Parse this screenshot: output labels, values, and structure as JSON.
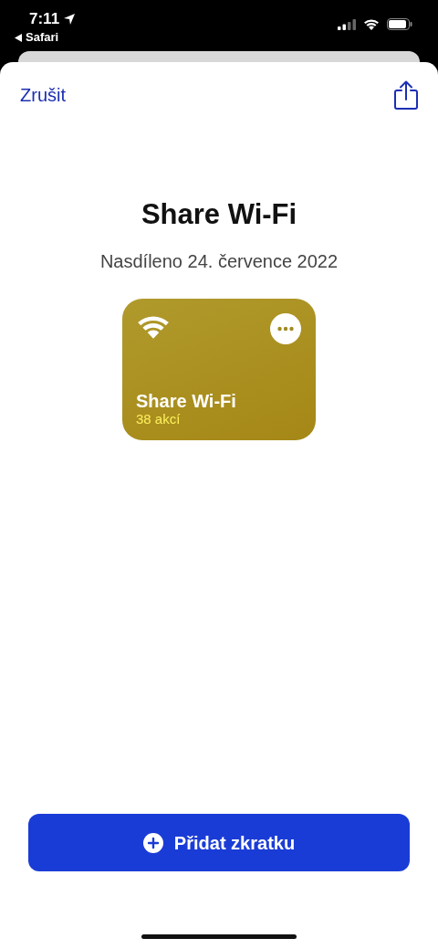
{
  "status_bar": {
    "time": "7:11",
    "back_app": "Safari"
  },
  "nav": {
    "cancel": "Zrušit"
  },
  "title": "Share Wi-Fi",
  "subtitle": "Nasdíleno 24. července 2022",
  "shortcut": {
    "name": "Share Wi-Fi",
    "count": "38 akcí",
    "color": "#b09a2c"
  },
  "primary_button": "Přidat zkratku"
}
